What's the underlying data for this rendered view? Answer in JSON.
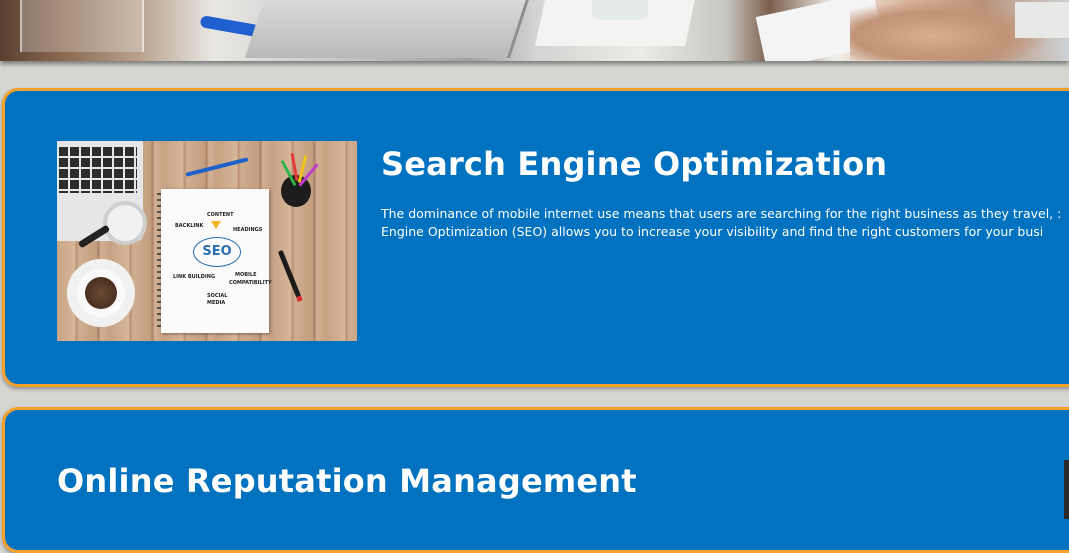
{
  "hero": {
    "image_alt": "team meeting around laptops"
  },
  "services": [
    {
      "title": "Search Engine Optimization",
      "description_line1": "The dominance of mobile internet use means that users are searching for the right business as they travel, :",
      "description_line2": "Engine Optimization (SEO) allows you to increase your visibility and find the right customers for your busi",
      "image": {
        "labels": {
          "content": "CONTENT",
          "backlink": "BACKLINK",
          "headings": "HEADINGS",
          "seo": "SEO",
          "link_building": "LINK BUILDING",
          "mobile": "MOBILE",
          "compatibility": "COMPATIBILITY",
          "social": "SOCIAL",
          "media": "MEDIA"
        }
      }
    },
    {
      "title": "Online Reputation Management"
    }
  ],
  "colors": {
    "card_background": "#0172bf",
    "card_border": "#f6a12a",
    "page_background": "#d6d7d2"
  }
}
